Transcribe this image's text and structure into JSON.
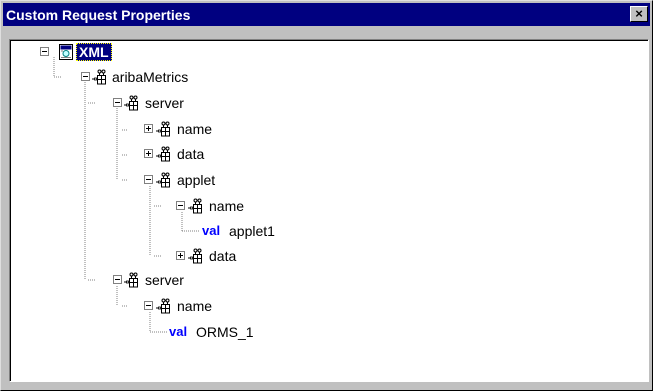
{
  "window": {
    "title": "Custom Request Properties",
    "close_glyph": "×"
  },
  "tree": {
    "root_label": "XML",
    "value_keyword": "val",
    "nodes": {
      "aribaMetrics": "aribaMetrics",
      "server_1": "server",
      "server_1_name": "name",
      "server_1_data": "data",
      "applet": "applet",
      "applet_name": "name",
      "applet_name_value": "applet1",
      "applet_data": "data",
      "server_2": "server",
      "server_2_name": "name",
      "server_2_name_value": "ORMS_1"
    }
  },
  "icons": {
    "root": "xml-document-icon",
    "element": "element-node-icon"
  }
}
